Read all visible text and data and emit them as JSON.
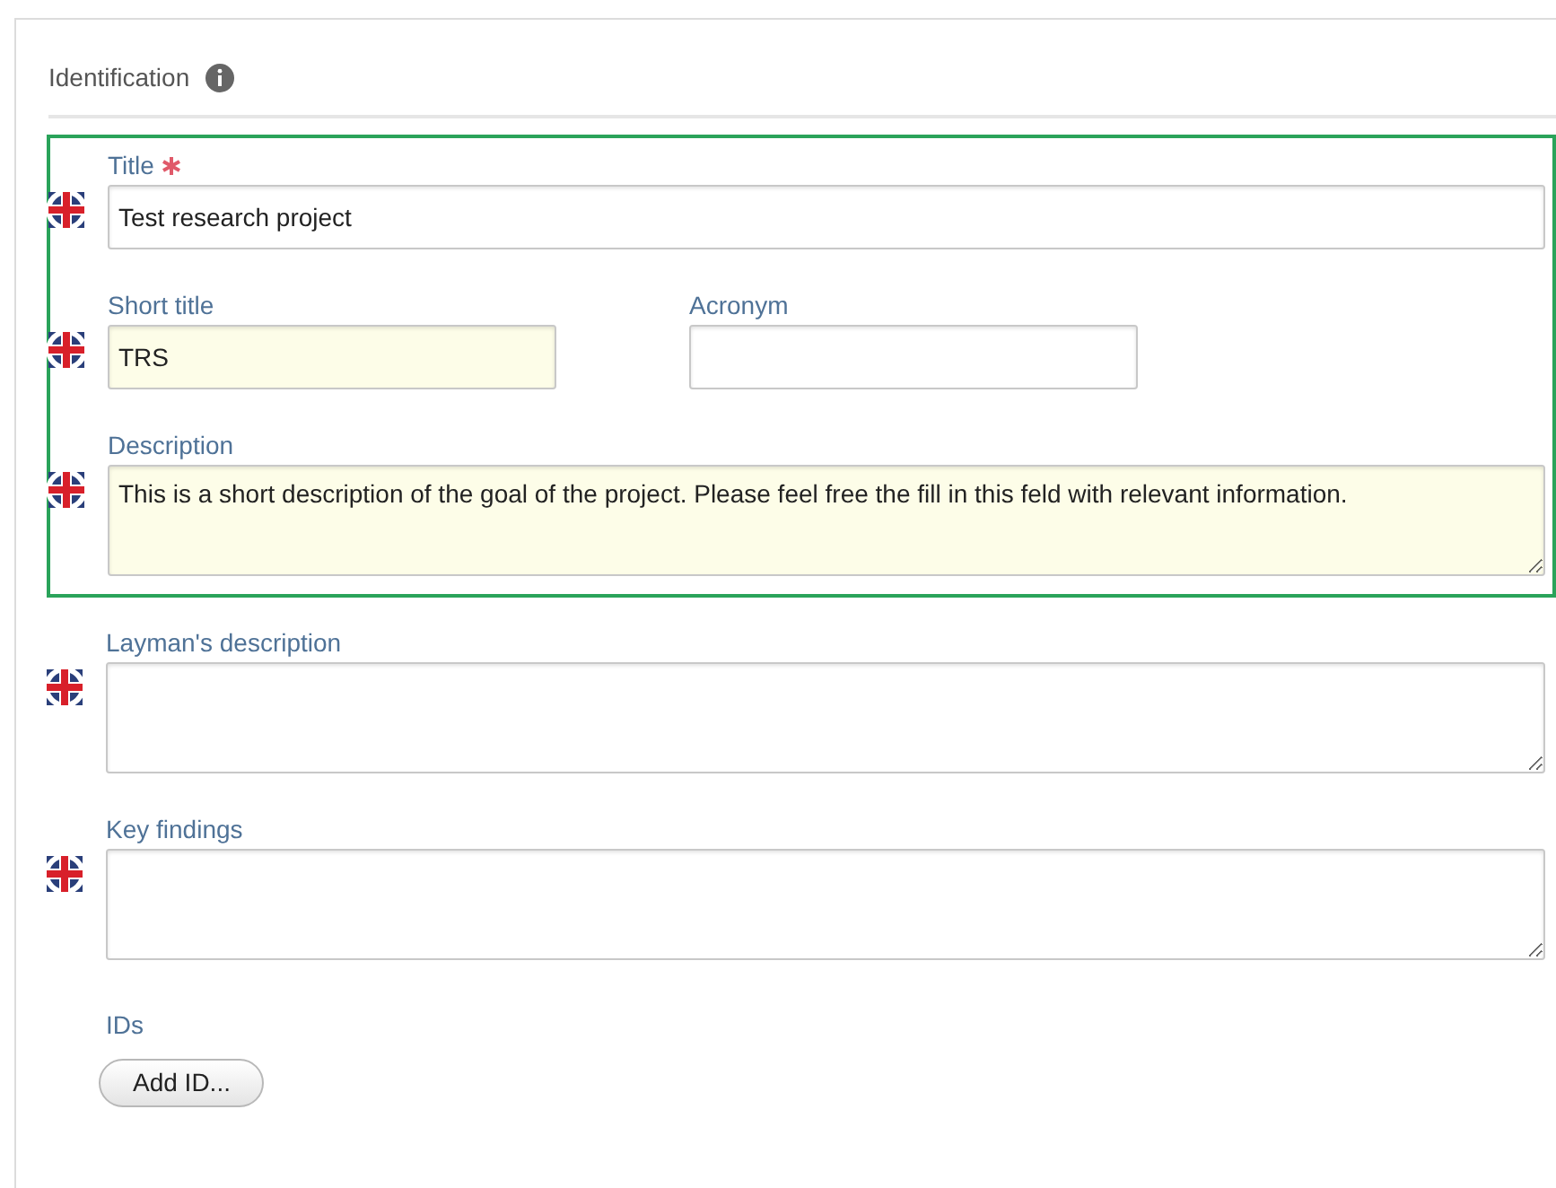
{
  "section": {
    "title": "Identification"
  },
  "group_rows": [
    [
      {
        "kind": "text",
        "label": "Title",
        "required": true,
        "translatable": true,
        "highlighted": false,
        "value": "Test research project"
      }
    ],
    [
      {
        "kind": "short",
        "label": "Short title",
        "required": false,
        "translatable": true,
        "highlighted": true,
        "value": "TRS"
      },
      {
        "kind": "short",
        "label": "Acronym",
        "required": false,
        "translatable": false,
        "highlighted": false
      }
    ],
    [
      {
        "kind": "textarea",
        "label": "Description",
        "required": false,
        "translatable": true,
        "highlighted": true,
        "value": "This is a short description of the goal of the project. Please feel free the fill in this feld with relevant information."
      }
    ]
  ],
  "rows": [
    [
      {
        "kind": "textarea",
        "label": "Layman's description",
        "required": false,
        "translatable": true,
        "highlighted": false
      }
    ],
    [
      {
        "kind": "textarea",
        "label": "Key findings",
        "required": false,
        "translatable": true,
        "highlighted": false
      }
    ]
  ],
  "ids": {
    "label": "IDs",
    "button": "Add ID..."
  }
}
